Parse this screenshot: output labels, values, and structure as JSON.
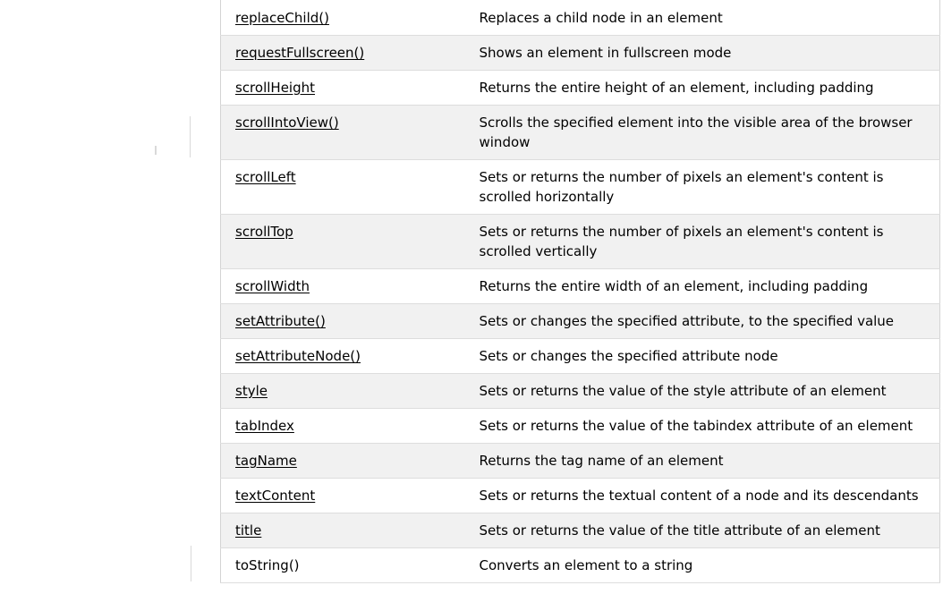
{
  "reference_table": {
    "rows": [
      {
        "name": "replaceChild()",
        "description": "Replaces a child node in an element",
        "linked": true
      },
      {
        "name": "requestFullscreen()",
        "description": "Shows an element in fullscreen mode",
        "linked": true
      },
      {
        "name": "scrollHeight",
        "description": "Returns the entire height of an element, including padding",
        "linked": true
      },
      {
        "name": "scrollIntoView()",
        "description": "Scrolls the specified element into the visible area of the browser window",
        "linked": true
      },
      {
        "name": "scrollLeft",
        "description": "Sets or returns the number of pixels an element's content is scrolled horizontally",
        "linked": true
      },
      {
        "name": "scrollTop",
        "description": "Sets or returns the number of pixels an element's content is scrolled vertically",
        "linked": true
      },
      {
        "name": "scrollWidth",
        "description": "Returns the entire width of an element, including padding",
        "linked": true
      },
      {
        "name": "setAttribute()",
        "description": "Sets or changes the specified attribute, to the specified value",
        "linked": true
      },
      {
        "name": "setAttributeNode()",
        "description": "Sets or changes the specified attribute node",
        "linked": true
      },
      {
        "name": "style",
        "description": "Sets or returns the value of the style attribute of an element",
        "linked": true
      },
      {
        "name": "tabIndex",
        "description": "Sets or returns the value of the tabindex attribute of an element",
        "linked": true
      },
      {
        "name": "tagName",
        "description": "Returns the tag name of an element",
        "linked": true
      },
      {
        "name": "textContent",
        "description": "Sets or returns the textual content of a node and its descendants",
        "linked": true
      },
      {
        "name": "title",
        "description": "Sets or returns the value of the title attribute of an element",
        "linked": true
      },
      {
        "name": "toString()",
        "description": "Converts an element to a string",
        "linked": false
      }
    ]
  },
  "colors": {
    "row_alt_background": "#f1f1f1",
    "border": "#dddddd",
    "text": "#000000"
  }
}
